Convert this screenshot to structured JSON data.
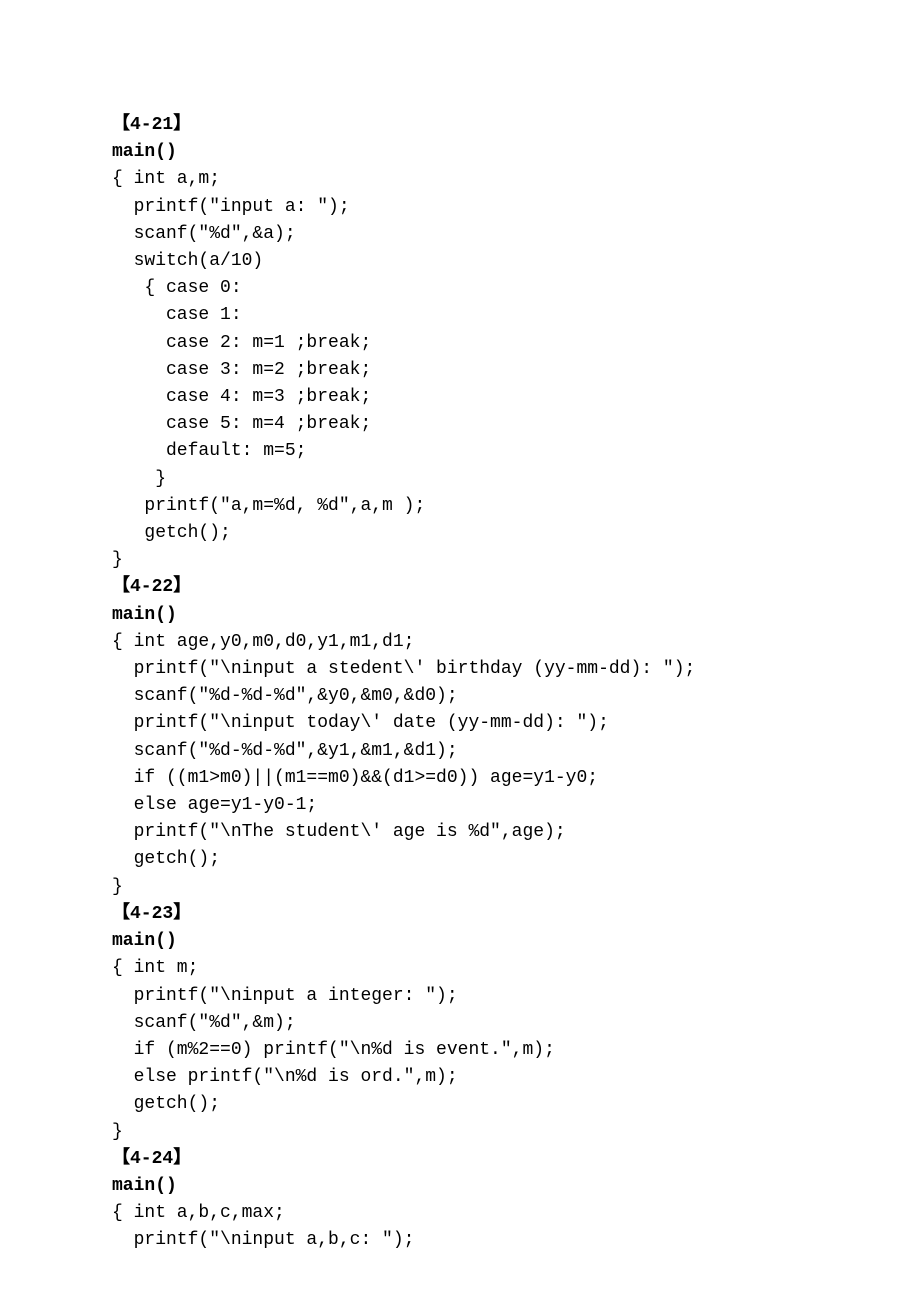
{
  "sections": [
    {
      "title": "【4-21】",
      "fn": "main()",
      "lines": [
        "{ int a,m;",
        "  printf(\"input a: \");",
        "  scanf(\"%d\",&a);",
        "  switch(a/10)",
        "   { case 0:",
        "     case 1:",
        "     case 2: m=1 ;break;",
        "     case 3: m=2 ;break;",
        "     case 4: m=3 ;break;",
        "     case 5: m=4 ;break;",
        "     default: m=5;",
        "    }",
        "   printf(\"a,m=%d, %d\",a,m );",
        "   getch();",
        "}"
      ]
    },
    {
      "title": "【4-22】",
      "fn": "main()",
      "lines": [
        "{ int age,y0,m0,d0,y1,m1,d1;",
        "  printf(\"\\ninput a stedent\\' birthday (yy-mm-dd): \");",
        "  scanf(\"%d-%d-%d\",&y0,&m0,&d0);",
        "  printf(\"\\ninput today\\' date (yy-mm-dd): \");",
        "  scanf(\"%d-%d-%d\",&y1,&m1,&d1);",
        "  if ((m1>m0)||(m1==m0)&&(d1>=d0)) age=y1-y0;",
        "  else age=y1-y0-1;",
        "  printf(\"\\nThe student\\' age is %d\",age);",
        "  getch();",
        "}"
      ]
    },
    {
      "title": "【4-23】",
      "fn": "main()",
      "lines": [
        "{ int m;",
        "  printf(\"\\ninput a integer: \");",
        "  scanf(\"%d\",&m);",
        "  if (m%2==0) printf(\"\\n%d is event.\",m);",
        "  else printf(\"\\n%d is ord.\",m);",
        "  getch();",
        "}"
      ]
    },
    {
      "title": "【4-24】",
      "fn": "main()",
      "lines": [
        "{ int a,b,c,max;",
        "  printf(\"\\ninput a,b,c: \");"
      ]
    }
  ]
}
